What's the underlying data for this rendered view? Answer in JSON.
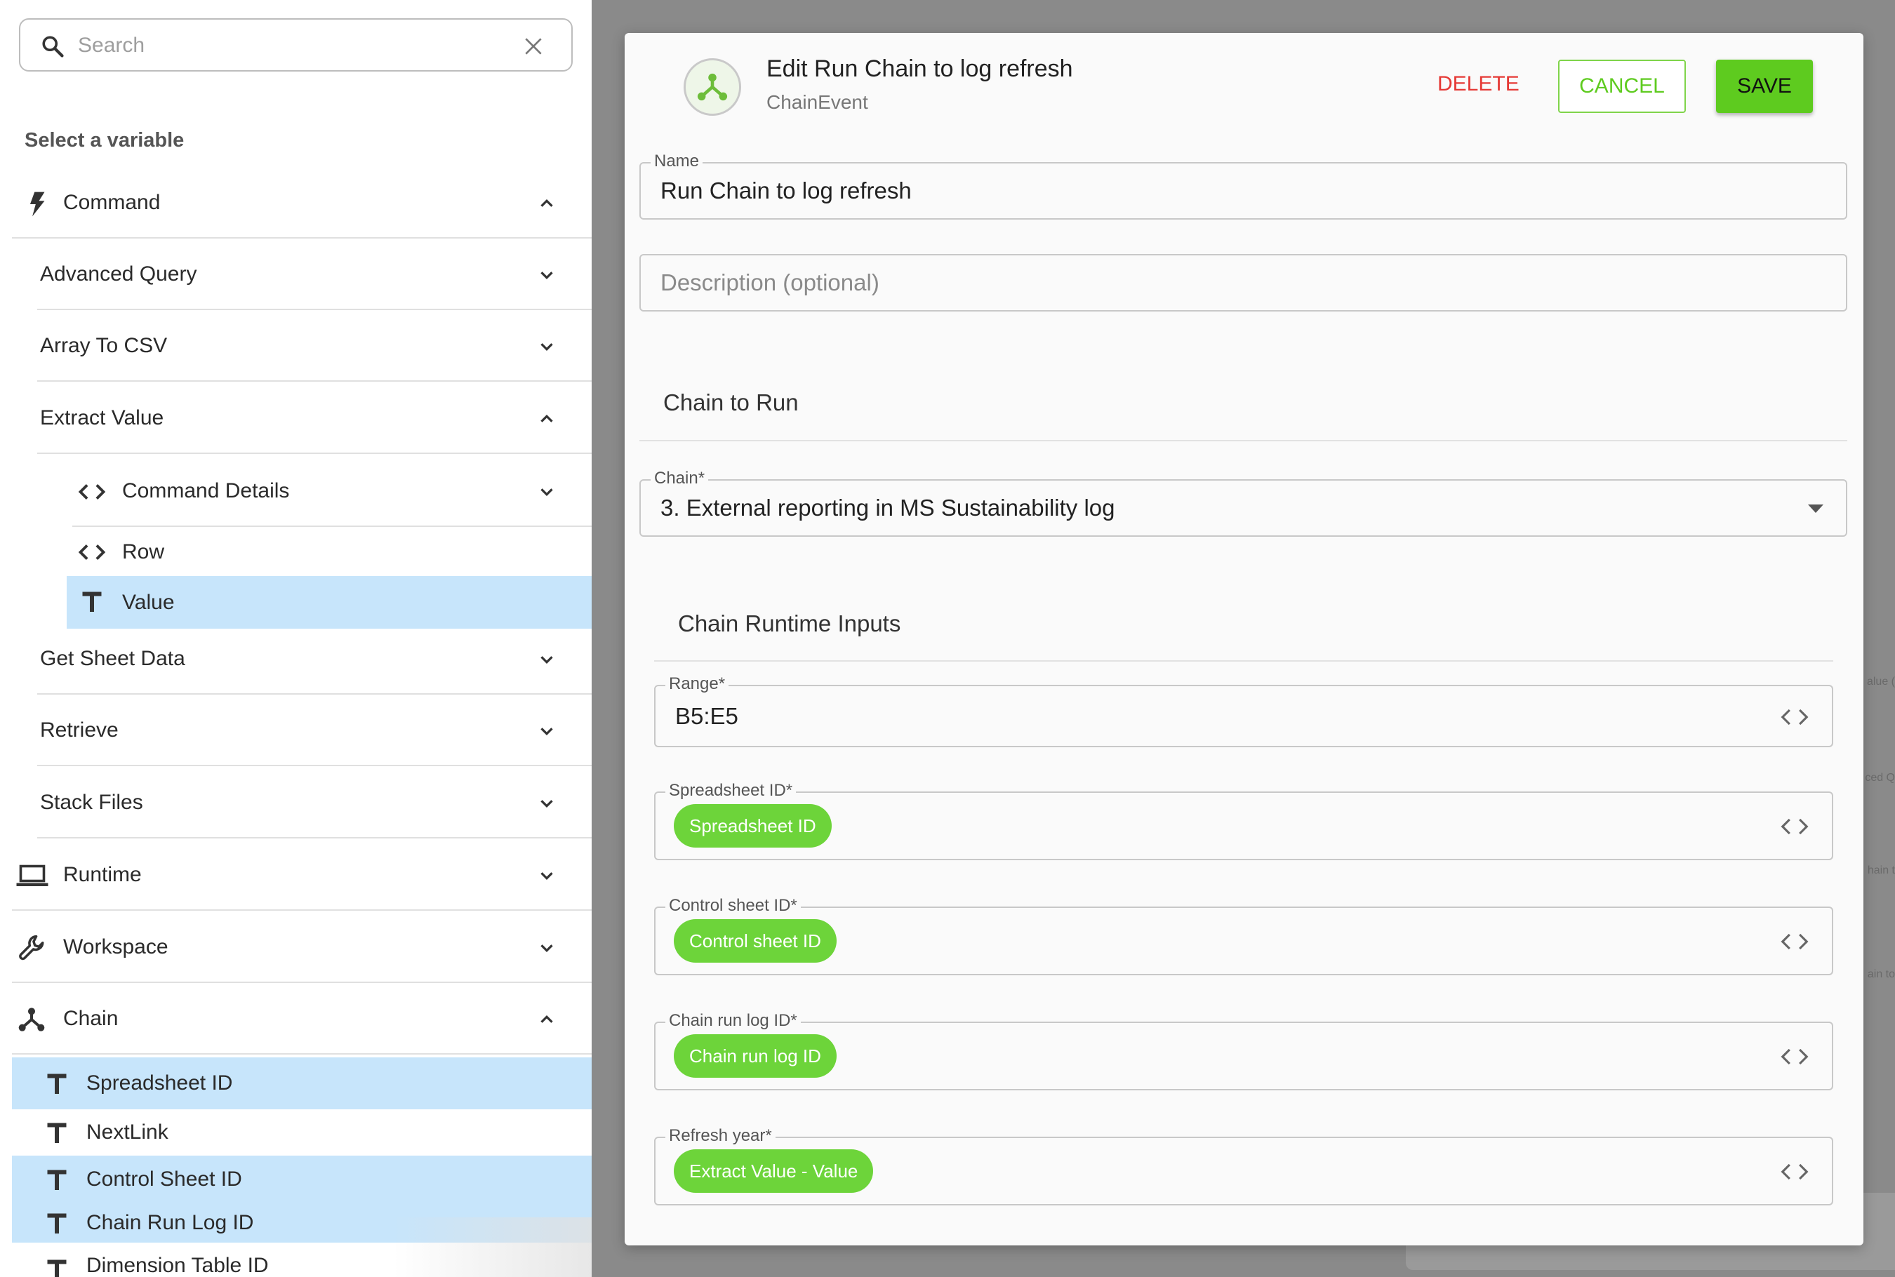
{
  "search": {
    "placeholder": "Search"
  },
  "variables": {
    "heading": "Select a variable",
    "command": "Command",
    "advanced_query": "Advanced Query",
    "array_to_csv": "Array To CSV",
    "extract_value": "Extract Value",
    "command_details": "Command Details",
    "row": "Row",
    "value": "Value",
    "get_sheet_data": "Get Sheet Data",
    "retrieve": "Retrieve",
    "stack_files": "Stack Files",
    "runtime": "Runtime",
    "workspace": "Workspace",
    "chain": "Chain",
    "spreadsheet_id": "Spreadsheet ID",
    "nextlink": "NextLink",
    "control_sheet_id": "Control Sheet ID",
    "chain_run_log_id": "Chain Run Log ID",
    "dimension_table_id": "Dimension Table ID"
  },
  "background": {
    "ghost_1": "alue (",
    "ghost_2": "ced Q",
    "ghost_3": "hain t",
    "ghost_4": "ain to"
  },
  "modal": {
    "title": "Edit Run Chain to log refresh",
    "subtitle": "ChainEvent",
    "delete": "DELETE",
    "cancel": "CANCEL",
    "save": "SAVE",
    "name_label": "Name",
    "name_value": "Run Chain to log refresh",
    "description_placeholder": "Description (optional)",
    "chain_to_run": "Chain to Run",
    "chain_label": "Chain*",
    "chain_value": "3. External reporting in MS Sustainability log",
    "runtime_inputs": "Chain Runtime Inputs",
    "range_label": "Range*",
    "range_value": "B5:E5",
    "spreadsheet_label": "Spreadsheet ID*",
    "spreadsheet_pill": "Spreadsheet ID",
    "control_label": "Control sheet ID*",
    "control_pill": "Control sheet ID",
    "chainlog_label": "Chain run log ID*",
    "chainlog_pill": "Chain run log ID",
    "refresh_label": "Refresh year*",
    "refresh_pill": "Extract Value - Value"
  },
  "colors": {
    "accent": "#5ecb1f",
    "pill": "#6dd43a",
    "danger": "#e53935",
    "selected": "#c7e5fb"
  }
}
